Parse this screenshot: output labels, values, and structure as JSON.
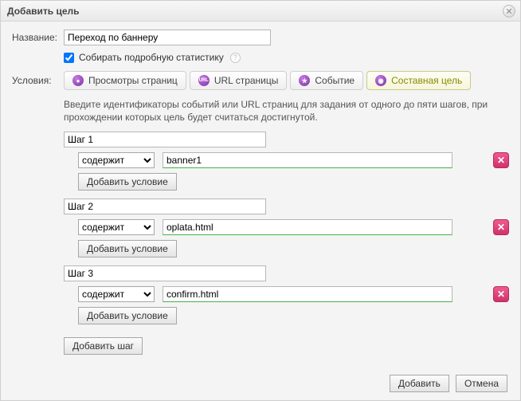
{
  "dialog": {
    "title": "Добавить цель"
  },
  "nameRow": {
    "label": "Название:",
    "value": "Переход по баннеру"
  },
  "collect": {
    "label": "Собирать подробную статистику",
    "checked": true
  },
  "conditionsRow": {
    "label": "Условия:"
  },
  "tabs": {
    "t0": {
      "label": "Просмотры страниц"
    },
    "t1": {
      "label": "URL страницы"
    },
    "t2": {
      "label": "Событие"
    },
    "t3": {
      "label": "Составная цель"
    }
  },
  "description": "Введите идентификаторы событий или URL страниц для задания от одного до пяти шагов, при прохождении которых цель будет считаться достигнутой.",
  "matchOptions": {
    "contains": "содержит"
  },
  "steps": {
    "s0": {
      "name": "Шаг 1",
      "value": "banner1"
    },
    "s1": {
      "name": "Шаг 2",
      "value": "oplata.html"
    },
    "s2": {
      "name": "Шаг 3",
      "value": "confirm.html"
    }
  },
  "buttons": {
    "addCondition": "Добавить условие",
    "addStep": "Добавить шаг",
    "add": "Добавить",
    "cancel": "Отмена"
  },
  "icons": {
    "tabViews": "●",
    "tabUrl": "URL",
    "tabEvent": "★",
    "tabComposite": "◉"
  }
}
